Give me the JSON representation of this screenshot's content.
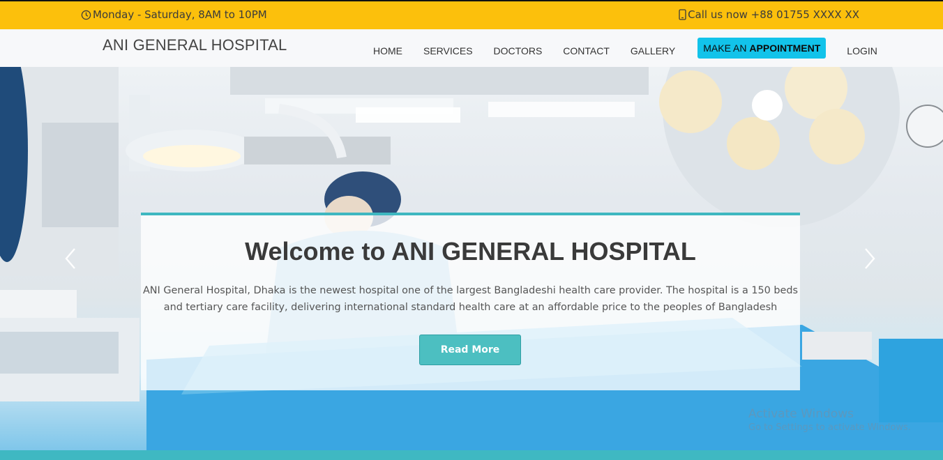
{
  "topbar": {
    "hours": "Monday - Saturday, 8AM to 10PM",
    "phone": "Call us now +88 01755 XXXX XX"
  },
  "navbar": {
    "brand": "ANI GENERAL HOSPITAL",
    "items": [
      "HOME",
      "SERVICES",
      "DOCTORS",
      "CONTACT",
      "GALLERY"
    ],
    "cta_prefix": "MAKE AN ",
    "cta_bold": "APPOINTMENT",
    "login": "LOGIN"
  },
  "hero": {
    "title": "Welcome to ANI GENERAL HOSPITAL",
    "text": "ANI General Hospital, Dhaka is the newest hospital one of the largest Bangladeshi health care provider. The hospital is a 150 beds and tertiary care facility, delivering international standard health care at an affordable price to the peoples of Bangladesh",
    "button": "Read More"
  },
  "watermark": {
    "line1": "Activate Windows",
    "line2": "Go to Settings to activate Windows."
  },
  "colors": {
    "topbar": "#fcc00c",
    "cta": "#12c3ea",
    "accent": "#3eb7c0"
  }
}
